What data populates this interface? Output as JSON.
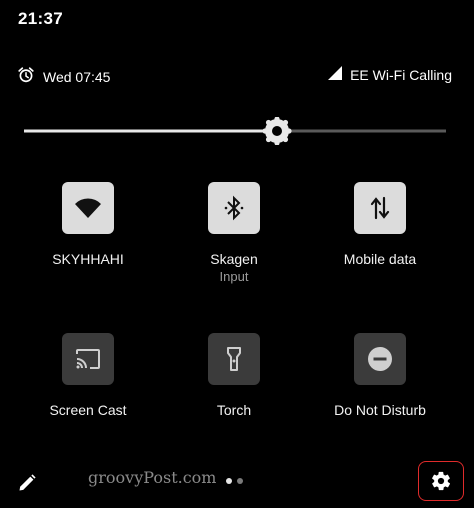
{
  "status_bar": {
    "time": "21:37"
  },
  "header": {
    "alarm_text": "Wed 07:45",
    "network_text": "EE Wi-Fi Calling"
  },
  "brightness": {
    "level": 0.6
  },
  "tiles": [
    {
      "label": "SKYHHAHI",
      "sub": "",
      "icon": "wifi-icon",
      "state": "on"
    },
    {
      "label": "Skagen",
      "sub": "Input",
      "icon": "bluetooth-icon",
      "state": "on"
    },
    {
      "label": "Mobile data",
      "sub": "",
      "icon": "mobile-data-icon",
      "state": "on"
    },
    {
      "label": "Screen Cast",
      "sub": "",
      "icon": "cast-icon",
      "state": "off"
    },
    {
      "label": "Torch",
      "sub": "",
      "icon": "torch-icon",
      "state": "off"
    },
    {
      "label": "Do Not Disturb",
      "sub": "",
      "icon": "dnd-icon",
      "state": "off"
    }
  ],
  "footer": {
    "watermark": "groovyPost.com",
    "pages": {
      "count": 2,
      "active": 0
    }
  },
  "colors": {
    "background": "#000000",
    "tile_on": "#dcdcdc",
    "tile_off": "#3b3b3b",
    "highlight": "#e02b2b"
  }
}
